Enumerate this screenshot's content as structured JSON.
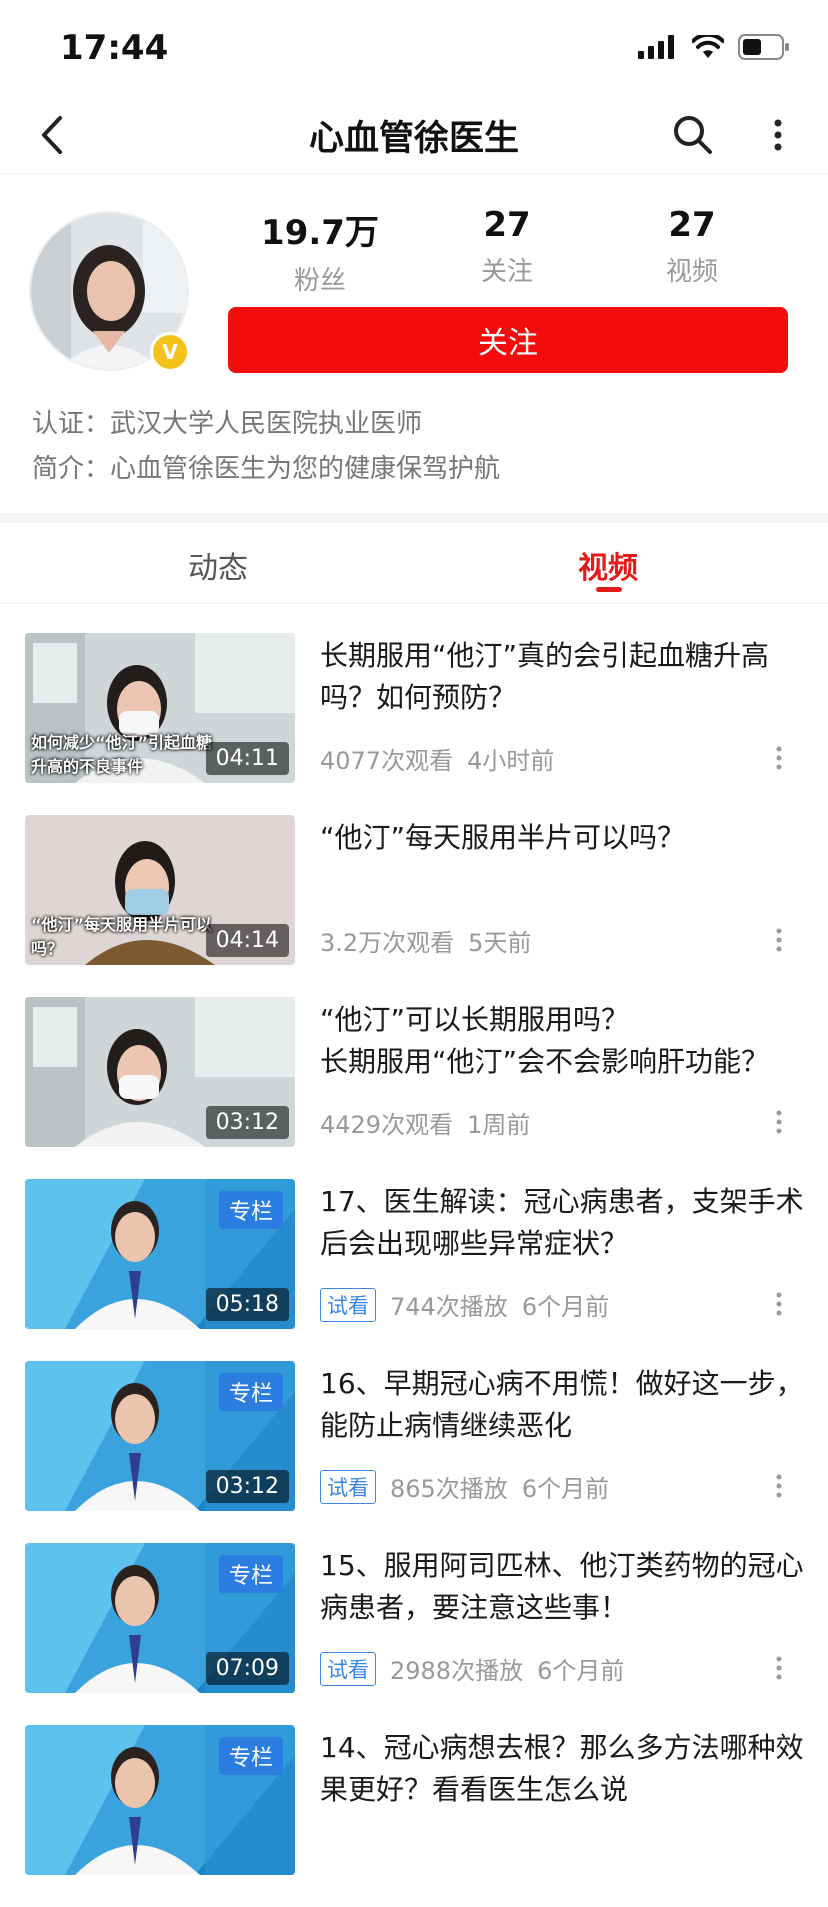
{
  "status_bar": {
    "time": "17:44"
  },
  "header": {
    "title": "心血管徐医生"
  },
  "profile": {
    "stats": [
      {
        "value": "19.7万",
        "label": "粉丝"
      },
      {
        "value": "27",
        "label": "关注"
      },
      {
        "value": "27",
        "label": "视频"
      }
    ],
    "follow_label": "关注",
    "verify_badge": "V",
    "certification": "认证：武汉大学人民医院执业医师",
    "intro": "简介：心血管徐医生为您的健康保驾护航"
  },
  "tabs": [
    {
      "label": "动态",
      "active": false
    },
    {
      "label": "视频",
      "active": true
    }
  ],
  "videos": [
    {
      "title": "长期服用“他汀”真的会引起血糖升高吗？如何预防？",
      "duration": "04:11",
      "views": "4077次观看",
      "time": "4小时前",
      "trial": "",
      "column": "",
      "thumb_style": "office",
      "thumb_caption": "如何减少“他汀”引起血糖升高的不良事件"
    },
    {
      "title": "“他汀”每天服用半片可以吗？",
      "duration": "04:14",
      "views": "3.2万次观看",
      "time": "5天前",
      "trial": "",
      "column": "",
      "thumb_style": "plain",
      "thumb_caption": "“他汀”每天服用半片可以吗？"
    },
    {
      "title": "“他汀”可以长期服用吗？\n长期服用“他汀”会不会影响肝功能？",
      "duration": "03:12",
      "views": "4429次观看",
      "time": "1周前",
      "trial": "",
      "column": "",
      "thumb_style": "office",
      "thumb_caption": ""
    },
    {
      "title": "17、医生解读：冠心病患者，支架手术后会出现哪些异常症状？",
      "duration": "05:18",
      "views": "744次播放",
      "time": "6个月前",
      "trial": "试看",
      "column": "专栏",
      "thumb_style": "studio",
      "thumb_caption": ""
    },
    {
      "title": "16、早期冠心病不用慌！做好这一步，能防止病情继续恶化",
      "duration": "03:12",
      "views": "865次播放",
      "time": "6个月前",
      "trial": "试看",
      "column": "专栏",
      "thumb_style": "studio",
      "thumb_caption": ""
    },
    {
      "title": "15、服用阿司匹林、他汀类药物的冠心病患者，要注意这些事！",
      "duration": "07:09",
      "views": "2988次播放",
      "time": "6个月前",
      "trial": "试看",
      "column": "专栏",
      "thumb_style": "studio",
      "thumb_caption": ""
    },
    {
      "title": "14、冠心病想去根？那么多方法哪种效果更好？看看医生怎么说",
      "duration": "",
      "views": "",
      "time": "",
      "trial": "",
      "column": "专栏",
      "thumb_style": "studio",
      "thumb_caption": ""
    }
  ],
  "colors": {
    "accent": "#e21b1b",
    "follow_button": "#f20c0c",
    "trial_blue": "#3a86e2",
    "verify_gold": "#f5c21b"
  }
}
